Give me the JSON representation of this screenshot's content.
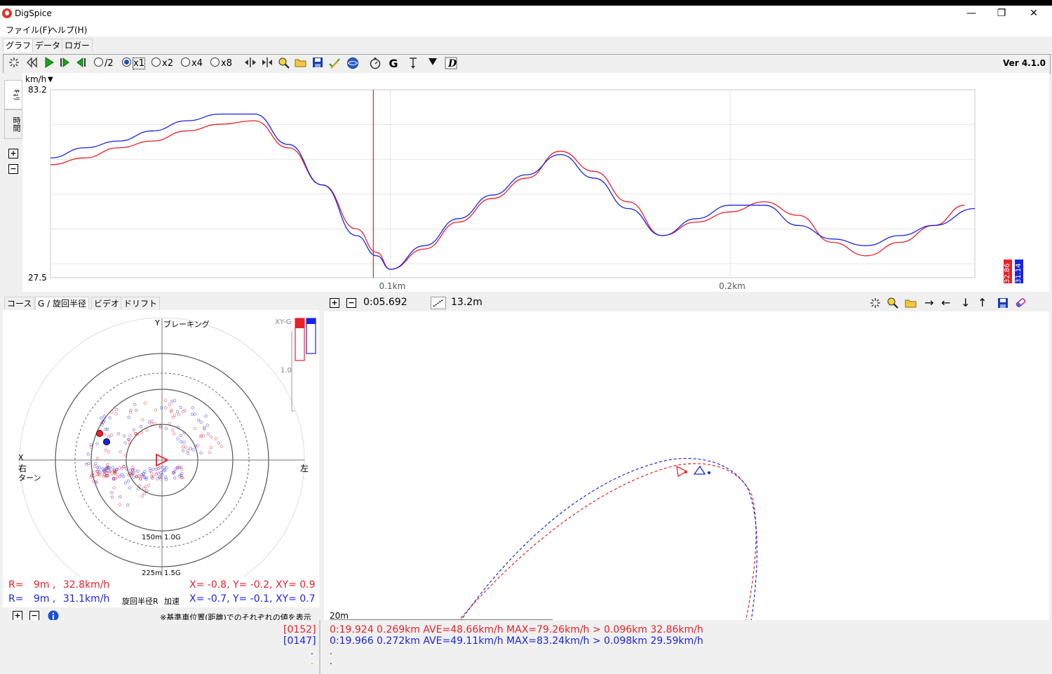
{
  "app": {
    "title": "DigSpice",
    "version": "Ver 4.1.0"
  },
  "window_controls": {
    "minimize": "—",
    "maximize": "❐",
    "close": "✕"
  },
  "menu": [
    "ファイル(F)",
    "ヘルプ(H)"
  ],
  "tabs": [
    "グラフ",
    "データ",
    "ロガー"
  ],
  "toolbar": {
    "speed_options": [
      "/2",
      "x1",
      "x2",
      "x4",
      "x8"
    ],
    "selected_speed": "x1"
  },
  "graph": {
    "unit": "km/h",
    "y_max": "83.2",
    "y_min": "27.5",
    "x_ticks": [
      "0.1km",
      "0.2km"
    ],
    "side_tabs": [
      "ｷｮﾘ",
      "時間"
    ],
    "legend_red": "32.86",
    "legend_blue": "31.14"
  },
  "chart_data": {
    "type": "line",
    "xlabel": "",
    "ylabel": "km/h",
    "ylim": [
      27.5,
      83.2
    ],
    "x_ticks": [
      "0.1km",
      "0.2km"
    ],
    "series": [
      {
        "color": "#e8202a",
        "x": [
          0.0,
          0.01,
          0.02,
          0.03,
          0.04,
          0.05,
          0.06,
          0.07,
          0.08,
          0.09,
          0.096,
          0.1,
          0.11,
          0.12,
          0.13,
          0.14,
          0.15,
          0.16,
          0.17,
          0.18,
          0.19,
          0.2,
          0.21,
          0.22,
          0.23,
          0.24,
          0.25,
          0.26,
          0.269
        ],
        "values": [
          61,
          63,
          66,
          68,
          71,
          73,
          74,
          66,
          55,
          42,
          35,
          30,
          36,
          44,
          51,
          57,
          65,
          59,
          50,
          40,
          44,
          47,
          50,
          46,
          38,
          34,
          38,
          43,
          49
        ]
      },
      {
        "color": "#1a24e0",
        "x": [
          0.0,
          0.01,
          0.02,
          0.03,
          0.04,
          0.05,
          0.06,
          0.07,
          0.08,
          0.09,
          0.096,
          0.1,
          0.11,
          0.12,
          0.13,
          0.14,
          0.15,
          0.16,
          0.17,
          0.18,
          0.19,
          0.2,
          0.21,
          0.22,
          0.23,
          0.24,
          0.25,
          0.26,
          0.272
        ],
        "values": [
          63,
          66,
          68,
          71,
          74,
          76,
          76,
          67,
          55,
          40,
          34,
          30,
          37,
          45,
          52,
          58,
          64,
          57,
          48,
          40,
          45,
          49,
          49,
          43,
          39,
          37,
          40,
          43,
          48
        ]
      }
    ],
    "marker_x": 0.095
  },
  "lower_left": {
    "tabs": [
      "コース",
      "G / 旋回半径",
      "ビデオ",
      "ドリフト"
    ],
    "braking_label": "ブレーキング",
    "y_axis": "Y",
    "x_axis": "X",
    "right_label": "右",
    "turn_label": "ターン",
    "left_label": "左",
    "xyg_label": "XY-G",
    "scale_label": "1.0",
    "ring1_radius": "150m",
    "ring1_g": "1.0G",
    "ring2_radius": "225m",
    "ring2_g": "1.5G",
    "row_red": {
      "r": "R=",
      "rval": "9m ,",
      "speed": "32.8km/h",
      "xy": "X= -0.8, Y= -0.2, XY= 0.9"
    },
    "row_blue": {
      "r": "R=",
      "rval": "9m ,",
      "speed": "31.1km/h",
      "xy": "X= -0.7, Y= -0.1, XY= 0.7"
    },
    "turn_radius_label": "旋回半径R",
    "accel_label": "加速",
    "footnote": "※基準車位置(距離)でのそれぞれの値を表示"
  },
  "lower_right": {
    "time": "0:05.692",
    "distance": "13.2m",
    "scale_bar": "20m"
  },
  "status": {
    "red_id": "[0152]",
    "blue_id": "[0147]",
    "red_line": "0:19.924 0.269km AVE=48.66km/h MAX=79.26km/h > 0.096km 32.86km/h",
    "blue_line": "0:19.966 0.272km AVE=49.11km/h MAX=83.24km/h > 0.098km 29.59km/h",
    "dot": "."
  },
  "colors": {
    "red": "#e8202a",
    "blue": "#1a24e0"
  }
}
